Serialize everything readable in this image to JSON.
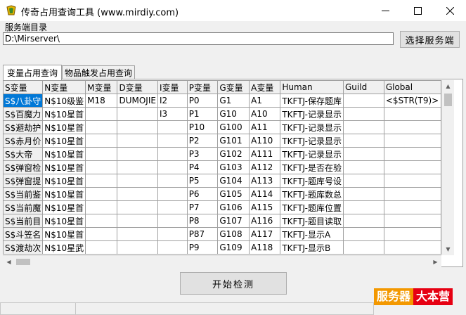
{
  "window": {
    "title": "传奇占用查询工具 (www.mirdiy.com)",
    "minimize_glyph": "—",
    "maximize_glyph": "☐",
    "close_glyph": "✕"
  },
  "server_dir": {
    "label": "服务端目录",
    "value": "D:\\Mirserver\\",
    "browse_button": "选择服务端"
  },
  "tabs": [
    {
      "label": "变量占用查询",
      "active": true
    },
    {
      "label": "物品触发占用查询",
      "active": false
    }
  ],
  "table": {
    "columns": [
      "S变量",
      "N变量",
      "M变量",
      "D变量",
      "I变量",
      "P变量",
      "G变量",
      "A变量",
      "Human",
      "Guild",
      "Global"
    ],
    "rows": [
      [
        "S$八卦守",
        "N$10级鉴",
        "M18",
        "DUMOJIE",
        "I2",
        "P0",
        "G1",
        "A1",
        "TKFTJ-保存题库",
        "",
        "<$STR(T9)>"
      ],
      [
        "S$百魔力",
        "N$10星首",
        "",
        "",
        "I3",
        "P1",
        "G10",
        "A10",
        "TKFTJ-记录显示",
        "",
        ""
      ],
      [
        "S$避劫护",
        "N$10星首",
        "",
        "",
        "",
        "P10",
        "G100",
        "A11",
        "TKFTJ-记录显示",
        "",
        ""
      ],
      [
        "S$赤月价",
        "N$10星首",
        "",
        "",
        "",
        "P2",
        "G101",
        "A110",
        "TKFTJ-记录显示",
        "",
        ""
      ],
      [
        "S$大帝",
        "N$10星首",
        "",
        "",
        "",
        "P3",
        "G102",
        "A111",
        "TKFTJ-记录显示",
        "",
        ""
      ],
      [
        "S$弹窗检",
        "N$10星首",
        "",
        "",
        "",
        "P4",
        "G103",
        "A112",
        "TKFTJ-是否在验",
        "",
        ""
      ],
      [
        "S$弹窗提",
        "N$10星首",
        "",
        "",
        "",
        "P5",
        "G104",
        "A113",
        "TKFTJ-题库号设",
        "",
        ""
      ],
      [
        "S$当前鉴",
        "N$10星首",
        "",
        "",
        "",
        "P6",
        "G105",
        "A114",
        "TKFTJ-题库数总",
        "",
        ""
      ],
      [
        "S$当前魔",
        "N$10星首",
        "",
        "",
        "",
        "P7",
        "G106",
        "A115",
        "TKFTJ-题库位置",
        "",
        ""
      ],
      [
        "S$当前目",
        "N$10星首",
        "",
        "",
        "",
        "P8",
        "G107",
        "A116",
        "TKFTJ-题目读取",
        "",
        ""
      ],
      [
        "S$斗笠名",
        "N$10星首",
        "",
        "",
        "",
        "P87",
        "G108",
        "A117",
        "TKFTJ-显示A",
        "",
        ""
      ],
      [
        "S$渡劫次",
        "N$10星武",
        "",
        "",
        "",
        "P9",
        "G109",
        "A118",
        "TKFTJ-显示B",
        "",
        ""
      ]
    ]
  },
  "start_button": "开始检测",
  "watermark": {
    "part1": "服务器",
    "part2": "大本营"
  }
}
